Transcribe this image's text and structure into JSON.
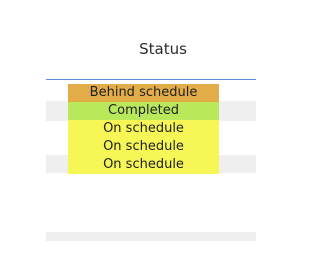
{
  "column": {
    "header": "Status"
  },
  "status_rows": [
    {
      "label": "Behind schedule",
      "color": "#e2ac48"
    },
    {
      "label": "Completed",
      "color": "#b9e85a"
    },
    {
      "label": "On schedule",
      "color": "#f6f656"
    },
    {
      "label": "On schedule",
      "color": "#f6f656"
    },
    {
      "label": "On schedule",
      "color": "#f6f656"
    }
  ],
  "colors": {
    "header_rule": "#5b8fd6",
    "alt_row": "#efefef"
  }
}
